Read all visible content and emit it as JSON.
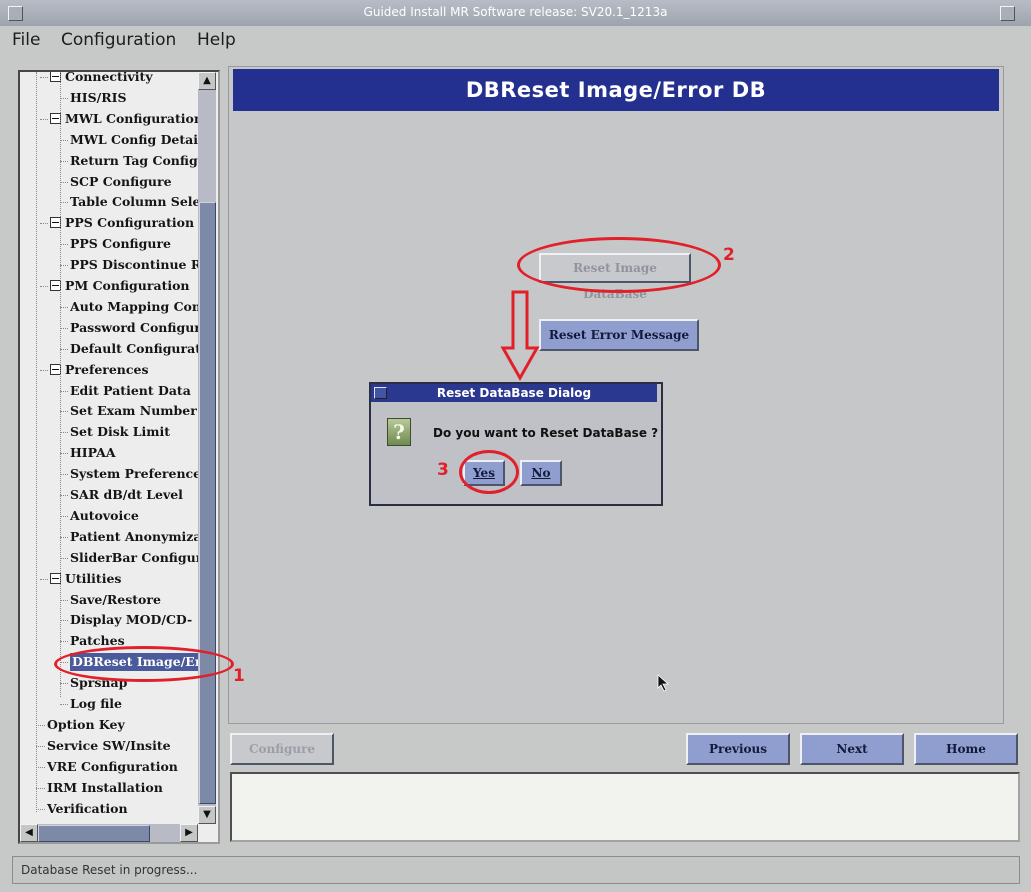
{
  "window": {
    "title": "Guided Install  MR Software release: SV20.1_1213a"
  },
  "menu": {
    "items": [
      "File",
      "Configuration",
      "Help"
    ]
  },
  "sidebar": {
    "items": [
      {
        "label": "Connectivity",
        "kind": "group"
      },
      {
        "label": "HIS/RIS",
        "kind": "leaf"
      },
      {
        "label": "MWL Configuration",
        "kind": "group"
      },
      {
        "label": "MWL Config Detail",
        "kind": "leaf"
      },
      {
        "label": "Return Tag Configu",
        "kind": "leaf"
      },
      {
        "label": "SCP Configure",
        "kind": "leaf"
      },
      {
        "label": "Table Column Sele",
        "kind": "leaf"
      },
      {
        "label": "PPS Configuration",
        "kind": "group"
      },
      {
        "label": "PPS Configure",
        "kind": "leaf"
      },
      {
        "label": "PPS Discontinue Re",
        "kind": "leaf"
      },
      {
        "label": "PM Configuration",
        "kind": "group"
      },
      {
        "label": "Auto Mapping Con",
        "kind": "leaf"
      },
      {
        "label": "Password Configur",
        "kind": "leaf"
      },
      {
        "label": "Default Configurat",
        "kind": "leaf"
      },
      {
        "label": "Preferences",
        "kind": "group"
      },
      {
        "label": "Edit Patient Data",
        "kind": "leaf"
      },
      {
        "label": "Set Exam Number",
        "kind": "leaf"
      },
      {
        "label": "Set Disk Limit",
        "kind": "leaf"
      },
      {
        "label": "HIPAA",
        "kind": "leaf"
      },
      {
        "label": "System Preferences",
        "kind": "leaf"
      },
      {
        "label": "SAR dB/dt Level",
        "kind": "leaf"
      },
      {
        "label": "Autovoice",
        "kind": "leaf"
      },
      {
        "label": "Patient Anonymiza",
        "kind": "leaf"
      },
      {
        "label": "SliderBar Configur",
        "kind": "leaf"
      },
      {
        "label": "Utilities",
        "kind": "group"
      },
      {
        "label": "Save/Restore",
        "kind": "leaf"
      },
      {
        "label": "Display MOD/CD-",
        "kind": "leaf"
      },
      {
        "label": "Patches",
        "kind": "leaf"
      },
      {
        "label": "DBReset Image/Err",
        "kind": "leaf",
        "selected": true
      },
      {
        "label": "Sprsnap",
        "kind": "leaf"
      },
      {
        "label": "Log file",
        "kind": "leaf"
      },
      {
        "label": "Option Key",
        "kind": "top"
      },
      {
        "label": "Service SW/Insite",
        "kind": "top"
      },
      {
        "label": "VRE Configuration",
        "kind": "top"
      },
      {
        "label": "IRM Installation",
        "kind": "top"
      },
      {
        "label": "Verification",
        "kind": "top"
      }
    ]
  },
  "main": {
    "header": "DBReset Image/Error DB",
    "reset_image_label": "Reset Image DataBase",
    "reset_error_label": "Reset Error Message"
  },
  "dialog": {
    "title": "Reset DataBase Dialog",
    "message": "Do you want to Reset DataBase ?",
    "yes_label": "Yes",
    "no_label": "No",
    "icon": "question-icon"
  },
  "footer": {
    "configure_label": "Configure",
    "previous_label": "Previous",
    "next_label": "Next",
    "home_label": "Home"
  },
  "status": {
    "text": "Database Reset in progress..."
  },
  "annotations": {
    "step1": "1",
    "step2": "2",
    "step3": "3",
    "color": "#e1202a"
  },
  "colors": {
    "header_bg": "#24308f",
    "button_active": "#8f9ecf",
    "selection": "#4a5a9a"
  }
}
